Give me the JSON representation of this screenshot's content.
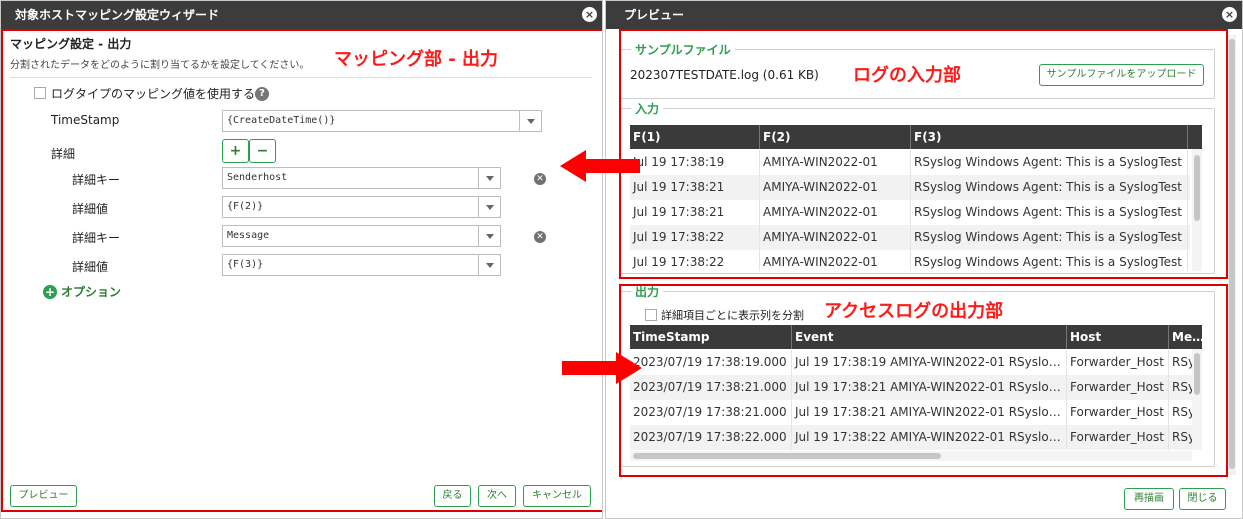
{
  "left": {
    "title": "対象ホストマッピング設定ウィザード",
    "close_glyph": "×",
    "heading": "マッピング設定 - 出力",
    "subtext": "分割されたデータをどのように割り当てるかを設定してください。",
    "checkbox_label": "ログタイプのマッピング値を使用する",
    "help_glyph": "?",
    "timestamp_label": "TimeStamp",
    "timestamp_value": "{CreateDateTime()}",
    "detail_label": "詳細",
    "plus_label": "+",
    "minus_label": "−",
    "details": [
      {
        "key_label": "詳細キー",
        "key_value": "Senderhost",
        "val_label": "詳細値",
        "val_value": "{F(2)}"
      },
      {
        "key_label": "詳細キー",
        "key_value": "Message",
        "val_label": "詳細値",
        "val_value": "{F(3)}"
      }
    ],
    "option_label": "オプション",
    "buttons": {
      "preview": "プレビュー",
      "back": "戻る",
      "next": "次へ",
      "cancel": "キャンセル"
    },
    "annotation": "マッピング部 - 出力"
  },
  "right": {
    "title": "プレビュー",
    "close_glyph": "×",
    "sample_section": "サンプルファイル",
    "file_name": "202307TESTDATE.log (0.61 KB)",
    "upload_button": "サンプルファイルをアップロード",
    "input_section": "入力",
    "input_columns": [
      "F(1)",
      "F(2)",
      "F(3)"
    ],
    "input_rows": [
      [
        "Jul 19 17:38:19",
        "AMIYA-WIN2022-01",
        "RSyslog Windows Agent: This is a SyslogTest"
      ],
      [
        "Jul 19 17:38:21",
        "AMIYA-WIN2022-01",
        "RSyslog Windows Agent: This is a SyslogTest"
      ],
      [
        "Jul 19 17:38:21",
        "AMIYA-WIN2022-01",
        "RSyslog Windows Agent: This is a SyslogTest"
      ],
      [
        "Jul 19 17:38:22",
        "AMIYA-WIN2022-01",
        "RSyslog Windows Agent: This is a SyslogTest"
      ],
      [
        "Jul 19 17:38:22",
        "AMIYA-WIN2022-01",
        "RSyslog Windows Agent: This is a SyslogTest"
      ]
    ],
    "output_section": "出力",
    "split_checkbox": "詳細項目ごとに表示列を分割",
    "output_columns": [
      "TimeStamp",
      "Event",
      "Host",
      "Messa"
    ],
    "output_rows": [
      [
        "2023/07/19 17:38:19.000",
        "Jul 19 17:38:19 AMIYA-WIN2022-01 RSyslo…",
        "Forwarder_Host",
        "RSy"
      ],
      [
        "2023/07/19 17:38:21.000",
        "Jul 19 17:38:21 AMIYA-WIN2022-01 RSyslo…",
        "Forwarder_Host",
        "RSy"
      ],
      [
        "2023/07/19 17:38:21.000",
        "Jul 19 17:38:21 AMIYA-WIN2022-01 RSyslo…",
        "Forwarder_Host",
        "RSy"
      ],
      [
        "2023/07/19 17:38:22.000",
        "Jul 19 17:38:22 AMIYA-WIN2022-01 RSyslo…",
        "Forwarder_Host",
        "RSy"
      ]
    ],
    "buttons": {
      "redraw": "再描画",
      "close": "閉じる"
    },
    "annotation_input": "ログの入力部",
    "annotation_output": "アクセスログの出力部"
  },
  "colors": {
    "accent_green": "#2e9e4f",
    "annotation_red": "#e00000",
    "titlebar": "#3c3c3c"
  }
}
